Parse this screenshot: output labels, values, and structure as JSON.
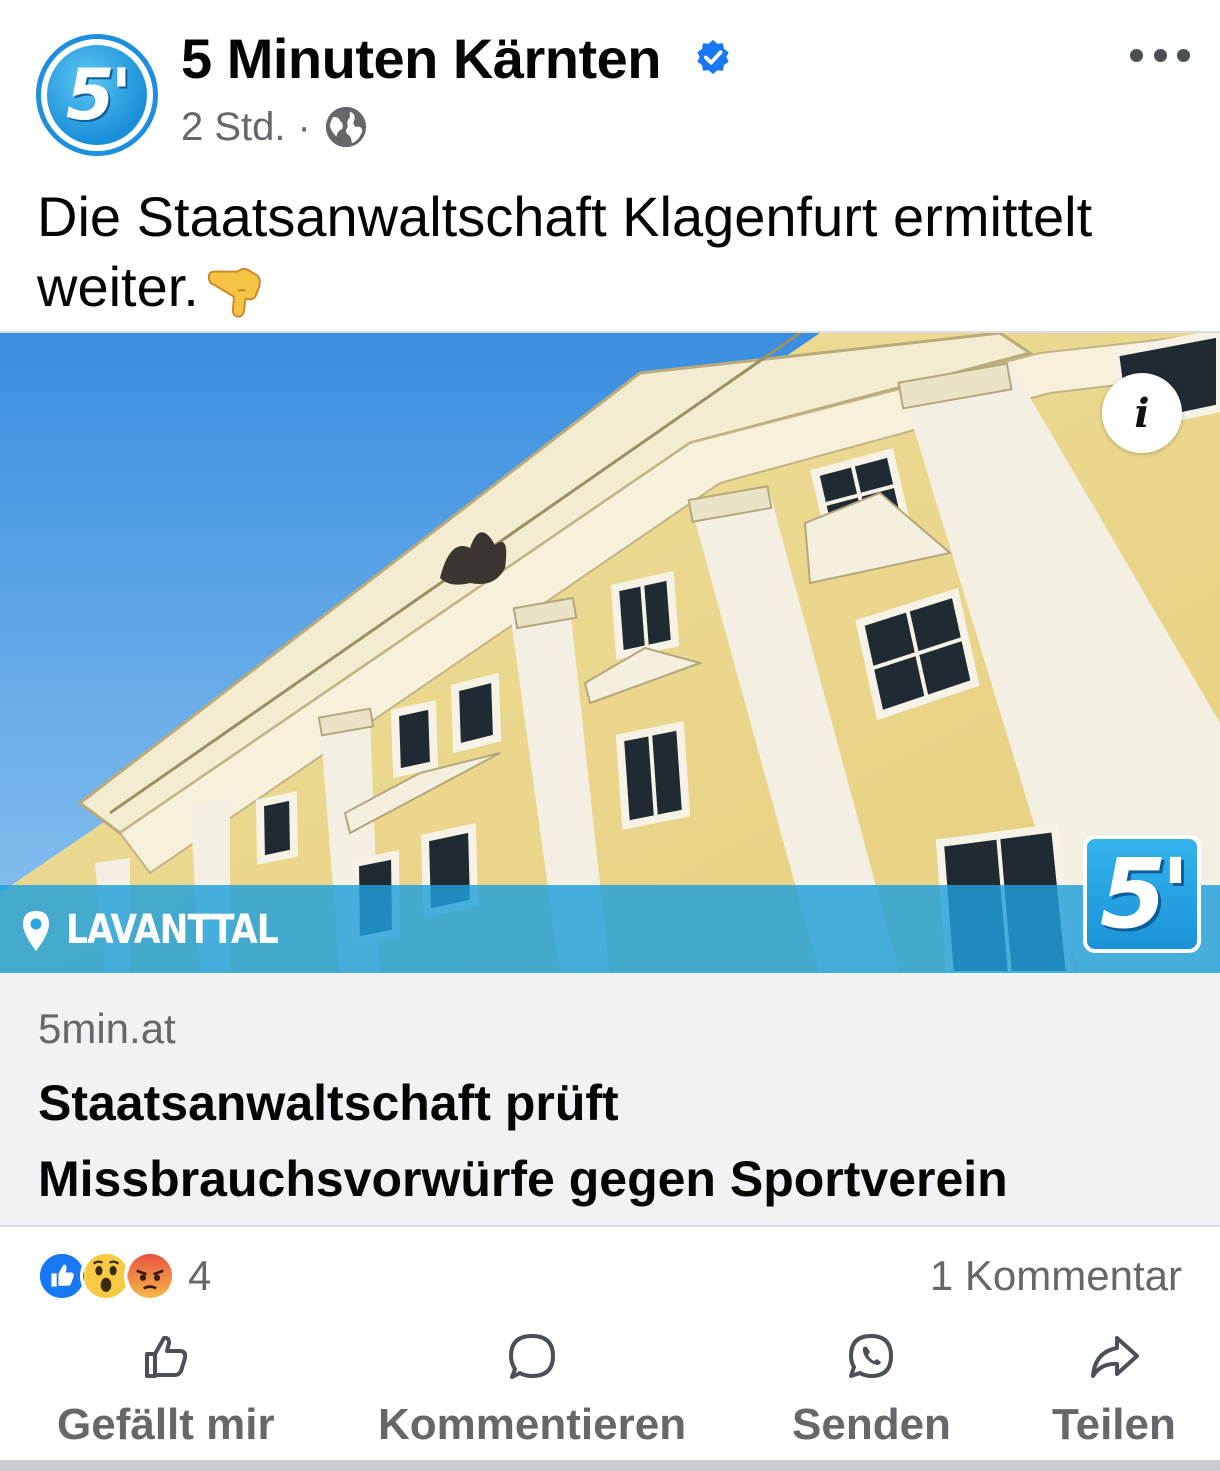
{
  "header": {
    "page_name": "5 Minuten Kärnten",
    "time": "2 Std.",
    "separator": "·",
    "avatar_text": "5'",
    "verified_icon": "verified-badge-icon",
    "audience_icon": "globe-icon"
  },
  "post": {
    "text": "Die Staatsanwaltschaft Klagenfurt ermittelt weiter.",
    "emoji": "pointing-down-emoji"
  },
  "image": {
    "location_label": "LAVANTTAL",
    "logo_text": "5'",
    "info_label": "i"
  },
  "link": {
    "domain": "5min.at",
    "headline_line1": "Staatsanwaltschaft prüft",
    "headline_line2": "Missbrauchsvorwürfe gegen Sportverein"
  },
  "stats": {
    "reaction_count": "4",
    "comments": "1 Kommentar",
    "reaction_icons": [
      "like-icon",
      "wow-icon",
      "angry-icon"
    ]
  },
  "actions": {
    "like": "Gefällt mir",
    "comment": "Kommentieren",
    "send": "Senden",
    "share": "Teilen"
  },
  "colors": {
    "brand_blue": "#1d8fe0",
    "facebook_blue": "#1877f2",
    "meta_gray": "#65676b",
    "link_bg": "#f0f2f5"
  }
}
